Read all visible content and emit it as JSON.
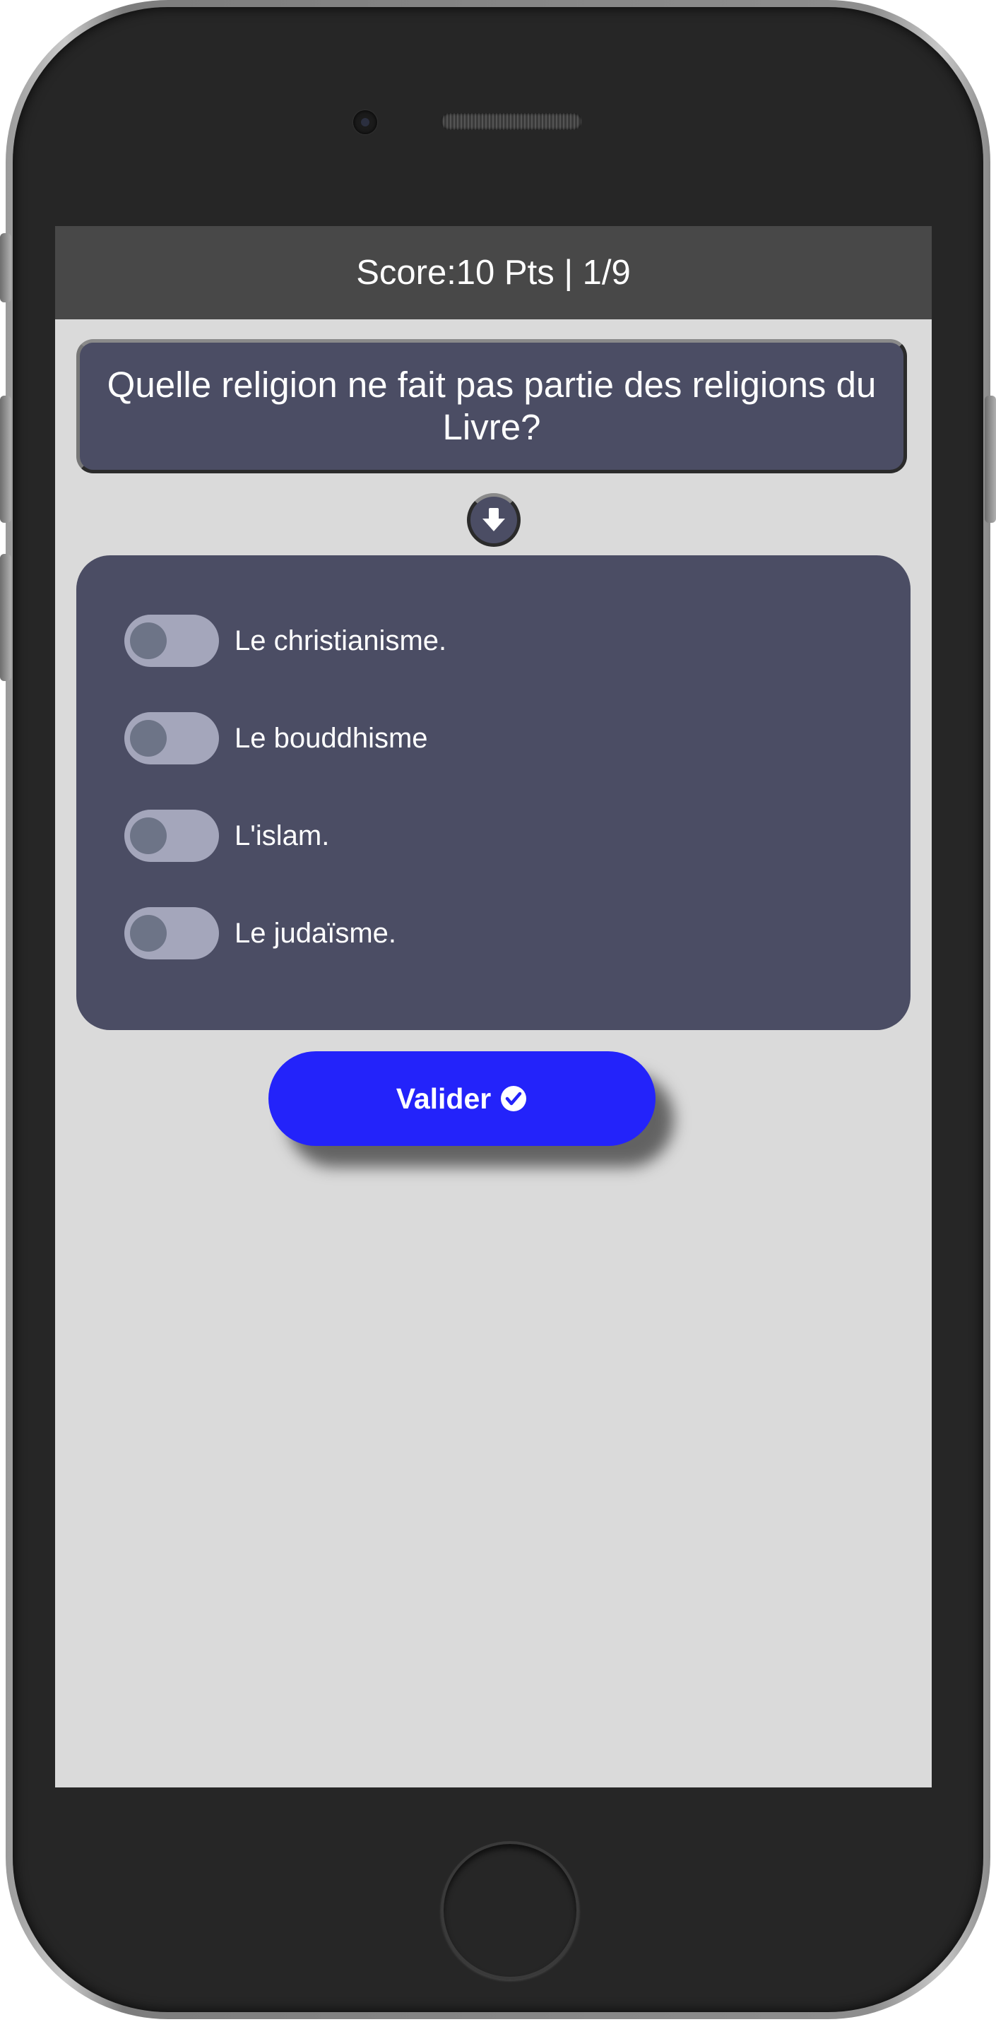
{
  "header": {
    "score_text": "Score:10 Pts | 1/9"
  },
  "question": {
    "text": "Quelle religion ne fait pas partie des religions du Livre?"
  },
  "answers": [
    {
      "label": "Le christianisme.",
      "checked": false
    },
    {
      "label": "Le bouddhisme",
      "checked": false
    },
    {
      "label": "L'islam.",
      "checked": false
    },
    {
      "label": "Le judaïsme.",
      "checked": false
    }
  ],
  "actions": {
    "validate_label": "Valider",
    "validate_icon": "check-circle-icon",
    "scroll_icon": "arrow-down-icon"
  },
  "colors": {
    "header_bg": "#484848",
    "panel_bg": "#4b4d64",
    "screen_bg": "#dadada",
    "button_bg": "#2323fa",
    "toggle_track": "#a4a6bb",
    "toggle_knob": "#6d7487"
  }
}
